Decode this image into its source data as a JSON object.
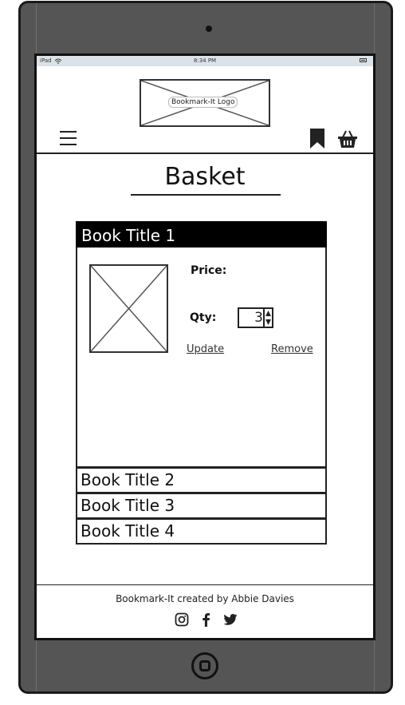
{
  "status_bar": {
    "carrier": "iPad",
    "time": "8:34 PM"
  },
  "header": {
    "logo_text": "Bookmark-It Logo"
  },
  "page": {
    "title": "Basket"
  },
  "basket": {
    "items": [
      {
        "title": "Book Title 1",
        "price_label": "Price:",
        "qty_label": "Qty:",
        "qty_value": "3",
        "update_label": "Update",
        "remove_label": "Remove",
        "expanded": true
      },
      {
        "title": "Book Title 2",
        "expanded": false
      },
      {
        "title": "Book Title 3",
        "expanded": false
      },
      {
        "title": "Book Title 4",
        "expanded": false
      }
    ]
  },
  "footer": {
    "text": "Bookmark-It created by Abbie Davies",
    "icons": [
      "instagram-icon",
      "facebook-icon",
      "twitter-icon"
    ]
  },
  "colors": {
    "device_frame": "#555555",
    "status_bar": "#dce3e8",
    "active_header": "#000000"
  }
}
